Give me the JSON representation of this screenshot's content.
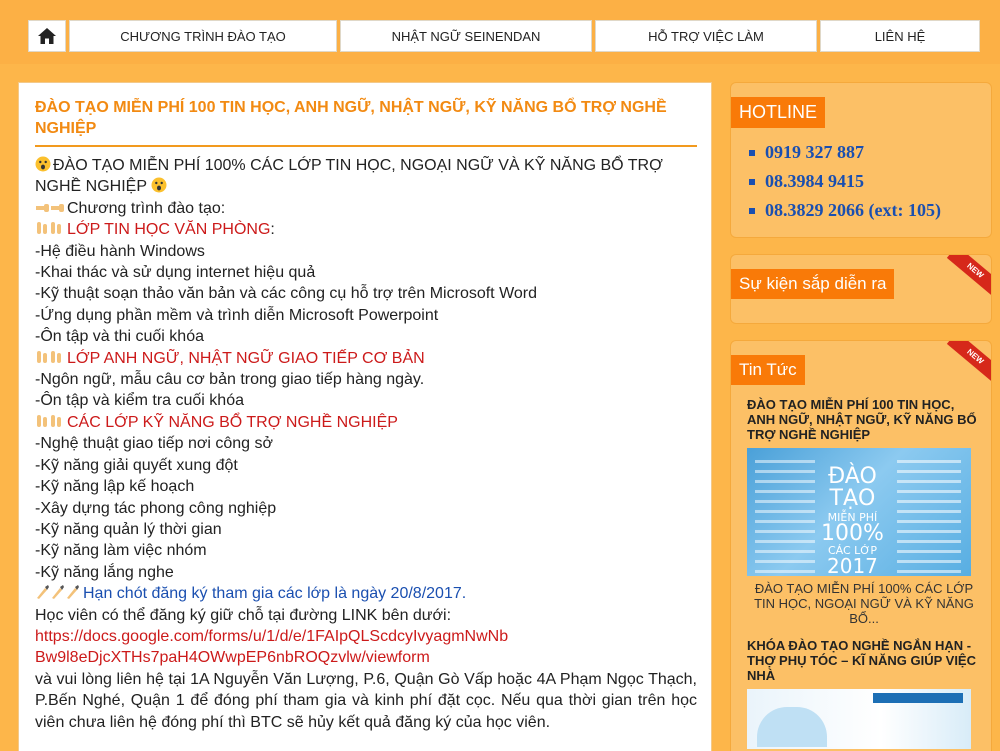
{
  "nav": {
    "items": [
      {
        "label": "CHƯƠNG TRÌNH ĐÀO TẠO"
      },
      {
        "label": "NHẬT NGỮ SEINENDAN"
      },
      {
        "label": "HỖ TRỢ VIỆC LÀM"
      },
      {
        "label": "LIÊN HỆ"
      }
    ]
  },
  "post": {
    "title": "ĐÀO TẠO MIỄN PHÍ 100 TIN HỌC, ANH NGỮ, NHẬT NGỮ, KỸ NĂNG BỔ TRỢ NGHỀ NGHIỆP",
    "intro": "ĐÀO TẠO MIỄN PHÍ 100% CÁC LỚP TIN HỌC, NGOẠI NGỮ VÀ KỸ NĂNG BỔ TRỢ NGHỀ NGHIỆP",
    "program_label": "Chương trình đào tạo:",
    "section1_title": "LỚP TIN HỌC VĂN PHÒNG",
    "section1_colon": ":",
    "section1_items": [
      "-Hệ điều hành Windows",
      "-Khai thác và sử dụng internet hiệu quả",
      "-Kỹ thuật soạn thảo văn bản và các công cụ hỗ trợ trên Microsoft Word",
      "-Ứng dụng phần mềm và trình diễn Microsoft Powerpoint",
      "-Ôn tập và thi cuối khóa"
    ],
    "section2_title": "LỚP ANH NGỮ, NHẬT NGỮ GIAO TIẾP CƠ BẢN",
    "section2_items": [
      "-Ngôn ngữ, mẫu câu cơ bản trong giao tiếp hàng ngày.",
      "-Ôn tập và kiểm tra cuối khóa"
    ],
    "section3_title": "CÁC LỚP KỸ NĂNG BỔ TRỢ NGHỀ NGHIỆP",
    "section3_items": [
      "-Nghệ thuật giao tiếp nơi công sở",
      "-Kỹ năng giải quyết xung đột",
      "-Kỹ năng lập kế hoạch",
      "-Xây dựng tác phong công nghiệp",
      "-Kỹ năng quản lý thời gian",
      "-Kỹ năng làm việc nhóm",
      "-Kỹ năng lắng nghe"
    ],
    "deadline": "Hạn chót đăng ký tham gia các lớp là ngày 20/8/2017.",
    "register_text": "Học viên có thể đăng ký giữ chỗ tại đường LINK bên dưới:",
    "link_line1": "https://docs.google.com/forms/u/1/d/e/1FAIpQLScdcyIvyagmNwNb",
    "link_line2": "Bw9l8eDjcXTHs7paH4OWwpEP6nbROQzvlw/viewform",
    "contact_text": "và vui lòng liên hệ tại 1A Nguyễn Văn Lượng, P.6, Quận Gò Vấp hoặc 4A Phạm Ngọc Thạch, P.Bến Nghé, Quận 1 để đóng phí tham gia và kinh phí đặt cọc. Nếu qua thời gian trên học viên chưa liên hệ đóng phí thì BTC sẽ hủy kết quả đăng ký của học viên."
  },
  "sidebar": {
    "hotline_title": "HOTLINE",
    "hotlines": [
      "0919 327 887",
      "08.3984 9415",
      "08.3829 2066 (ext: 105)"
    ],
    "events_title": "Sự kiện sắp diễn ra",
    "news_title": "Tin Tức",
    "ribbon_text": "NEW",
    "news": [
      {
        "title": "ĐÀO TẠO MIỄN PHÍ 100 TIN HỌC, ANH NGỮ, NHẬT NGỮ, KỸ NĂNG BỔ TRỢ NGHỀ NGHIỆP",
        "thumb_l1": "ĐÀO",
        "thumb_l2": "TẠO",
        "thumb_l3": "MIỄN PHÍ",
        "thumb_l4": "100%",
        "thumb_l5": "CÁC LỚP",
        "thumb_l6": "2017",
        "desc": "ĐÀO TẠO MIỄN PHÍ 100% CÁC LỚP TIN HỌC, NGOẠI NGỮ VÀ KỸ NĂNG BỔ..."
      },
      {
        "title": "KHÓA ĐÀO TẠO NGHỀ NGẮN HẠN - THỢ PHỤ TÓC – KĨ NĂNG GIÚP VIỆC NHÀ"
      }
    ]
  },
  "colors": {
    "background": "#fdb64a",
    "accent_orange": "#f97a08",
    "title_orange": "#f28a12",
    "red_text": "#cc1a1a",
    "blue_text": "#1a4fb0"
  }
}
